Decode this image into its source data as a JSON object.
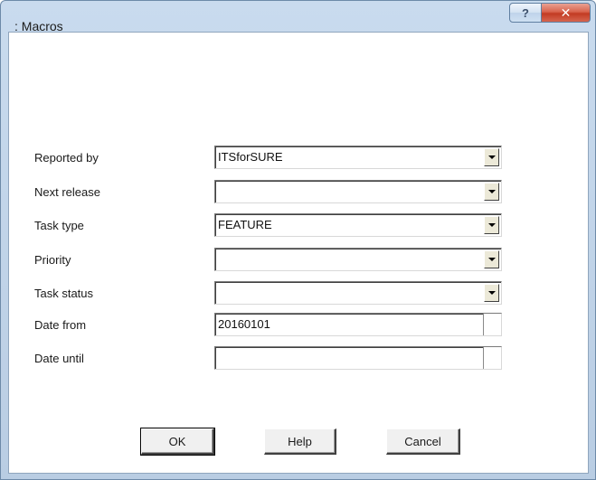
{
  "window": {
    "title": ": Macros",
    "help_glyph": "?",
    "close_glyph": "✕"
  },
  "form": {
    "fields": [
      {
        "label": "Reported by",
        "value": "ITSforSURE",
        "kind": "combo"
      },
      {
        "label": "Next release",
        "value": "",
        "kind": "combo"
      },
      {
        "label": "Task type",
        "value": "FEATURE",
        "kind": "combo"
      },
      {
        "label": "Priority",
        "value": "",
        "kind": "combo"
      },
      {
        "label": "Task status",
        "value": "",
        "kind": "combo"
      },
      {
        "label": "Date from",
        "value": "20160101",
        "kind": "date"
      },
      {
        "label": "Date until",
        "value": "",
        "kind": "date"
      }
    ]
  },
  "buttons": {
    "ok": "OK",
    "help": "Help",
    "cancel": "Cancel"
  },
  "colors": {
    "frame": "#c9dbee",
    "close": "#c23b22"
  },
  "icons": {
    "help": "help-icon",
    "close": "close-icon",
    "dropdown": "chevron-down-icon"
  }
}
